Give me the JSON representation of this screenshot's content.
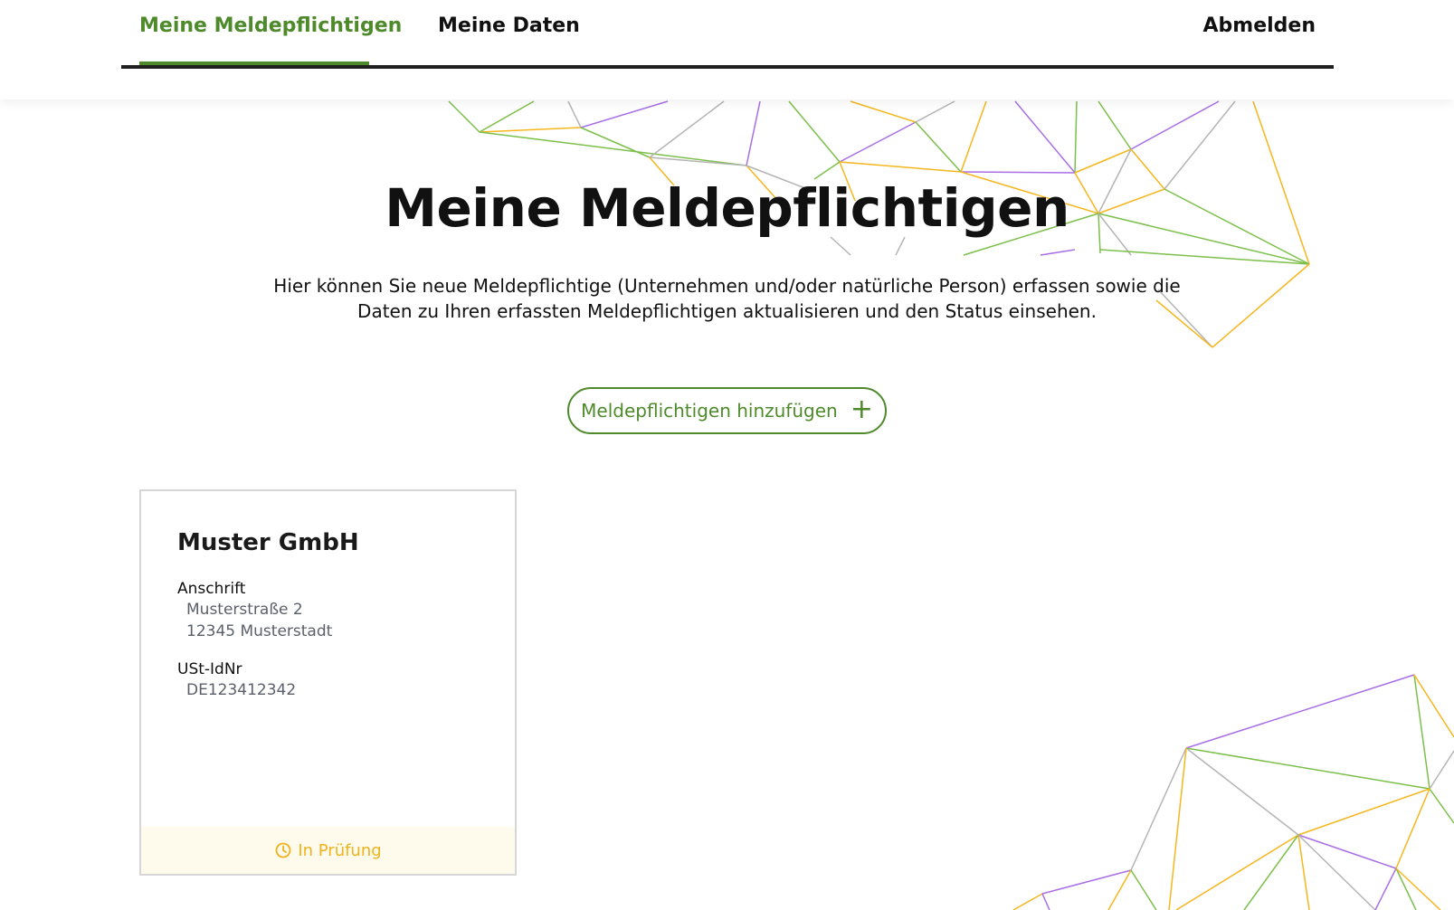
{
  "nav": {
    "items": [
      {
        "label": "Meine Meldepflichtigen",
        "active": true
      },
      {
        "label": "Meine Daten",
        "active": false
      }
    ],
    "logout_label": "Abmelden"
  },
  "page": {
    "title": "Meine Meldepflichtigen",
    "description": "Hier können Sie neue Meldepflichtige (Unternehmen und/oder natürliche Person) erfassen sowie die Daten zu Ihren erfassten Meldepflichtigen aktualisieren und den Status einsehen."
  },
  "add_button": {
    "label": "Meldepflichtigen hinzufügen",
    "icon": "plus-icon"
  },
  "cards": [
    {
      "name": "Muster GmbH",
      "address_label": "Anschrift",
      "address_lines": [
        "Musterstraße 2",
        "12345 Musterstadt"
      ],
      "vat_label": "USt-IdNr",
      "vat_value": "DE123412342",
      "status": "In Prüfung",
      "status_icon": "clock-icon"
    }
  ],
  "colors": {
    "accent_green": "#4e8a2b",
    "status_yellow": "#f0b21c",
    "status_bg": "#fefbed",
    "line_purple": "#a86ee6",
    "line_gray": "#b4b4b4",
    "line_orange": "#f6b61e"
  }
}
